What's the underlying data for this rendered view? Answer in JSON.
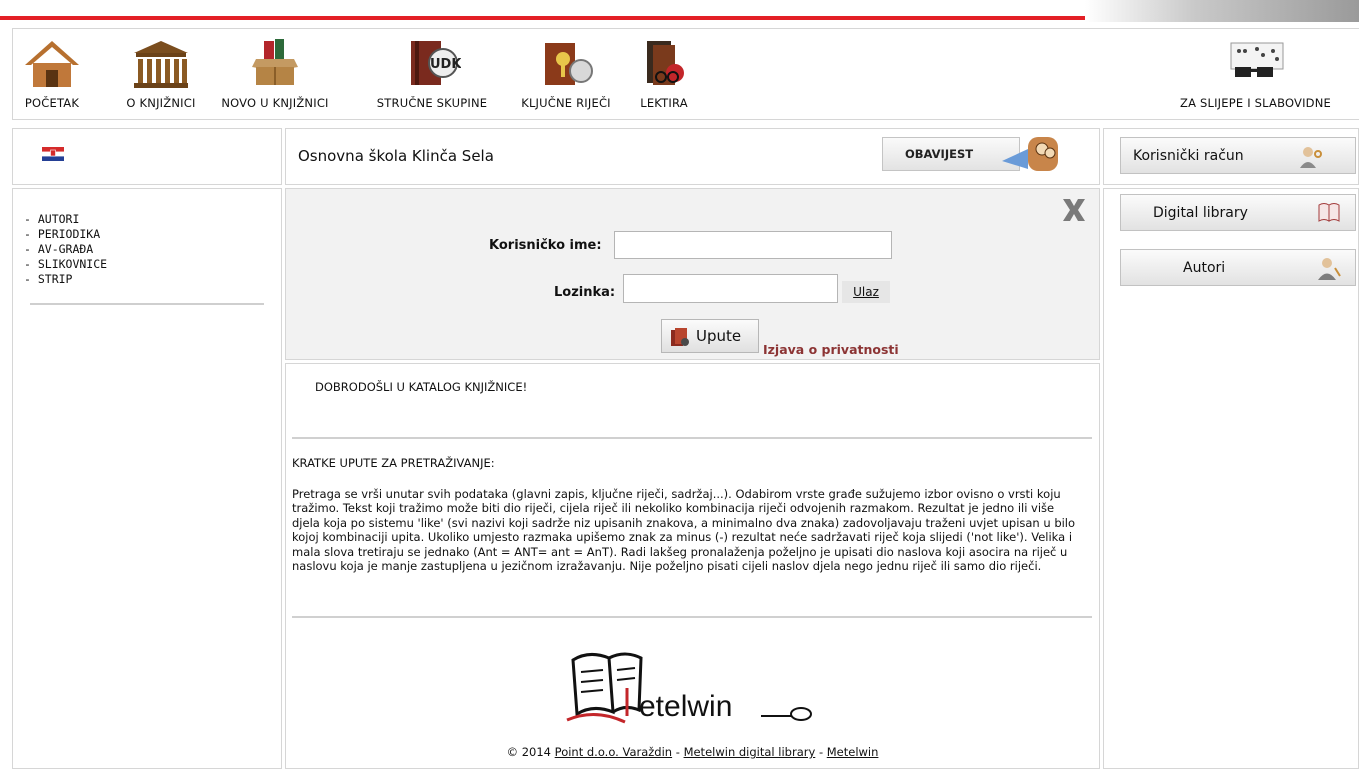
{
  "nav": {
    "items": [
      {
        "label": "POČETAK",
        "icon": "house-icon"
      },
      {
        "label": "O KNJIŽNICI",
        "icon": "library-building-icon"
      },
      {
        "label": "NOVO U KNJIŽNICI",
        "icon": "new-books-box-icon"
      },
      {
        "label": "STRUČNE SKUPINE",
        "icon": "udk-book-icon"
      },
      {
        "label": "KLJUČNE RIJEČI",
        "icon": "keyword-search-icon"
      },
      {
        "label": "LEKTIRA",
        "icon": "reading-books-icon"
      }
    ],
    "accessibility": {
      "label": "ZA SLIJEPE I SLABOVIDNE",
      "icon": "braille-glasses-icon"
    }
  },
  "header": {
    "language_flag": "croatian-flag-icon",
    "school_name": "Osnovna škola Klinča Sela",
    "notices_button": "OBAVIJEST"
  },
  "sidebar_right": {
    "account_button": "Korisnički račun",
    "digital_library_button": "Digital library",
    "authors_button": "Autori"
  },
  "left_menu": {
    "items": [
      "- AUTORI",
      "- PERIODIKA",
      "- AV-GRAĐA",
      "- SLIKOVNICE",
      "- STRIP"
    ]
  },
  "login": {
    "username_label": "Korisničko ime:",
    "username_value": "",
    "password_label": "Lozinka:",
    "password_value": "",
    "submit_label": "Ulaz",
    "help_button": "Upute",
    "privacy_link": "Izjava o privatnosti"
  },
  "main": {
    "welcome": "DOBRODOŠLI U KATALOG KNJIŽNICE!",
    "instructions_title": "KRATKE UPUTE ZA PRETRAŽIVANJE:",
    "instructions_text": "Pretraga se vrši unutar svih podataka (glavni zapis, ključne riječi, sadržaj...). Odabirom vrste građe sužujemo izbor ovisno o vrsti koju tražimo. Tekst koji tražimo može biti dio riječi, cijela riječ ili nekoliko kombinacija riječi odvojenih razmakom. Rezultat je jedno ili više djela koja po sistemu 'like' (svi nazivi koji sadrže niz upisanih znakova, a minimalno dva znaka) zadovoljavaju traženi uvjet upisan u bilo kojoj kombinaciji upita. Ukoliko umjesto razmaka upišemo znak za minus (-) rezultat neće sadržavati riječ koja slijedi ('not like'). Velika i mala slova tretiraju se jednako (Ant = ANT= ant = AnT). Radi lakšeg pronalaženja poželjno je upisati dio naslova koji asocira na riječ u naslovu koja je manje zastupljena u jezičnom izražavanju. Nije poželjno pisati cijeli naslov djela nego jednu riječ ili samo dio riječi."
  },
  "logo": {
    "text": "etelwin"
  },
  "footer": {
    "copyright": "© 2014",
    "company_link": "Point d.o.o. Varaždin",
    "sep": "-",
    "digital_library_link": "Metelwin digital library",
    "metelwin_link": "Metelwin"
  },
  "colors": {
    "accent_red": "#e31f26",
    "link_dark_red": "#8c3434",
    "panel_gray": "#f2f2f2"
  }
}
